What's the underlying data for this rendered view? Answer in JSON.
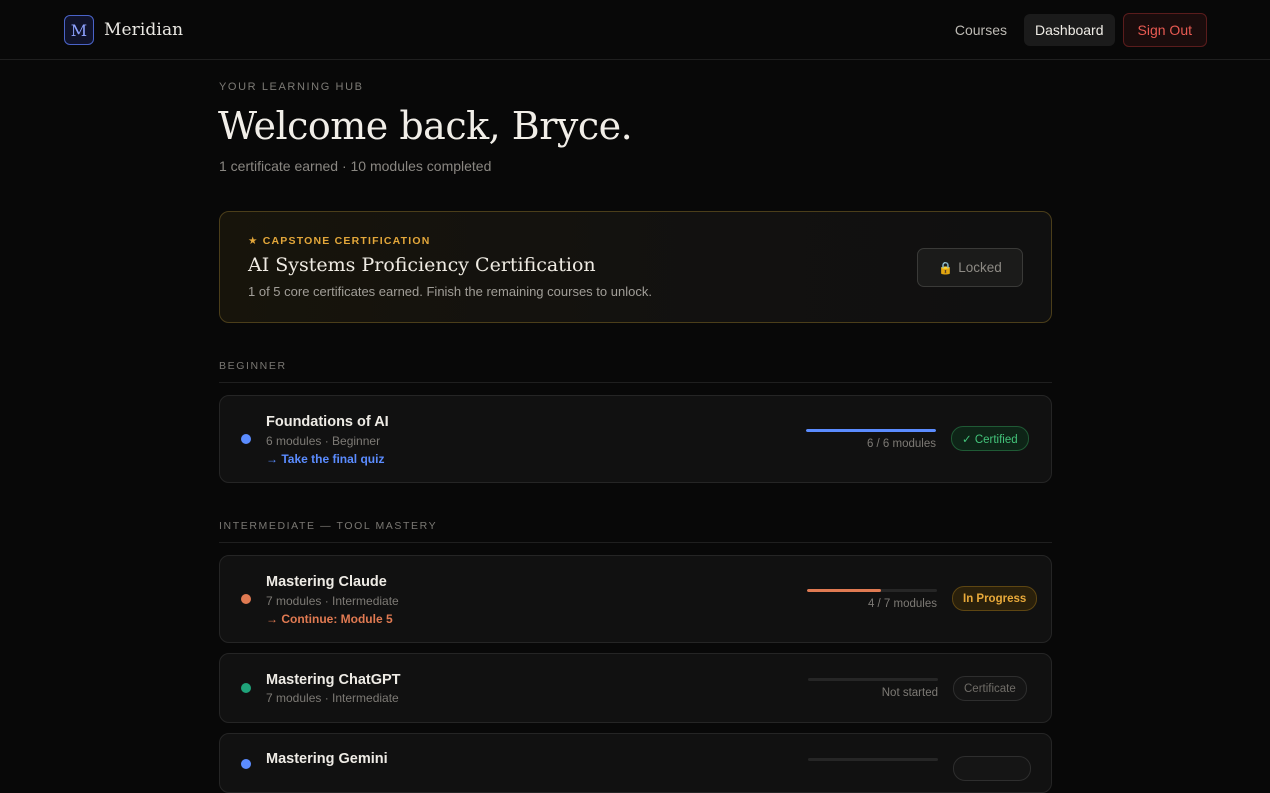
{
  "brand": {
    "mark": "M",
    "name": "Meridian"
  },
  "nav": {
    "courses": "Courses",
    "dashboard": "Dashboard",
    "signout": "Sign Out"
  },
  "hero": {
    "eyebrow": "YOUR LEARNING HUB",
    "title": "Welcome back, Bryce.",
    "subtitle": "1 certificate earned · 10 modules completed"
  },
  "capstone": {
    "eyebrow": "★ CAPSTONE CERTIFICATION",
    "title": "AI Systems Proficiency Certification",
    "subtitle": "1 of 5 core certificates earned. Finish the remaining courses to unlock.",
    "locked_icon": "🔒",
    "locked_label": "Locked"
  },
  "sections": {
    "beginner": "BEGINNER",
    "intermediate": "INTERMEDIATE — TOOL MASTERY"
  },
  "courses": [
    {
      "title": "Foundations of AI",
      "meta": "6 modules · Beginner",
      "cta": "→ Take the final quiz",
      "progress": 1.0,
      "progress_label": "6 / 6 modules",
      "badge": "✓ Certified",
      "color": "#5b8cff"
    },
    {
      "title": "Mastering Claude",
      "meta": "7 modules · Intermediate",
      "cta": "→ Continue: Module 5",
      "progress": 0.571,
      "progress_label": "4 / 7 modules",
      "badge": "In Progress",
      "color": "#e07a52"
    },
    {
      "title": "Mastering ChatGPT",
      "meta": "7 modules · Intermediate",
      "progress": 0,
      "progress_label": "Not started",
      "badge": "Certificate",
      "color": "#1fa37a"
    },
    {
      "title": "Mastering Gemini",
      "color": "#5b8cff"
    }
  ]
}
